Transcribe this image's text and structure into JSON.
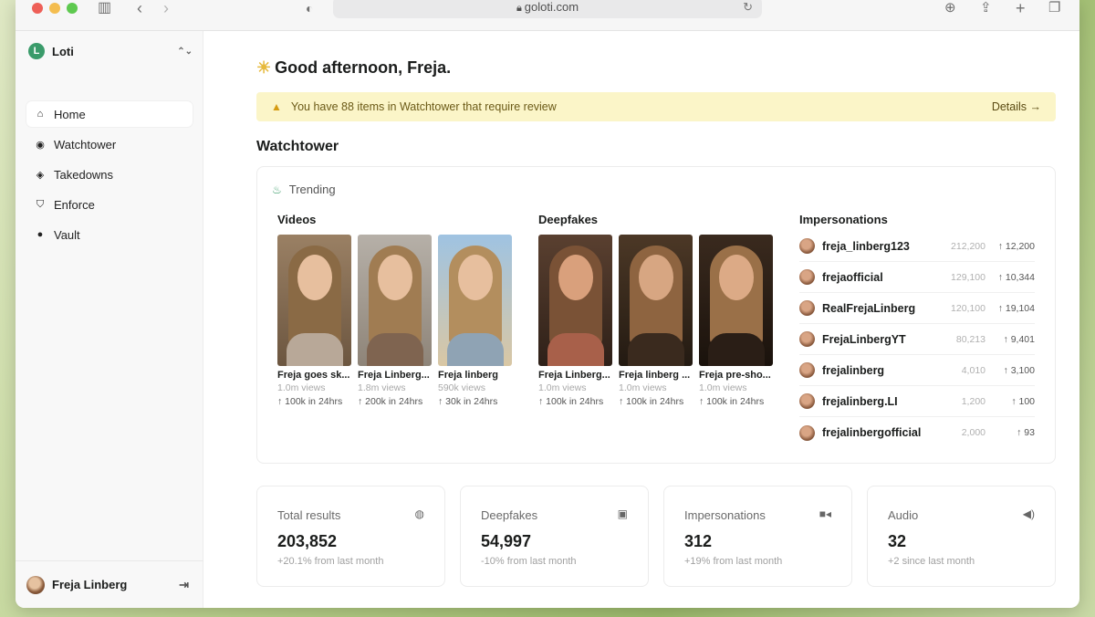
{
  "browser": {
    "url": "goloti.com",
    "icons": [
      "sidebar-toggle-icon",
      "back-icon",
      "forward-icon",
      "shield-icon",
      "lock-icon",
      "reload-icon",
      "download-icon",
      "share-icon",
      "new-tab-icon",
      "tabs-icon"
    ]
  },
  "sidebar": {
    "org_initial": "L",
    "org_name": "Loti",
    "items": [
      {
        "label": "Home",
        "icon": "home-icon",
        "active": true
      },
      {
        "label": "Watchtower",
        "icon": "watchtower-icon",
        "active": false
      },
      {
        "label": "Takedowns",
        "icon": "layers-icon",
        "active": false
      },
      {
        "label": "Enforce",
        "icon": "shield-check-icon",
        "active": false
      },
      {
        "label": "Vault",
        "icon": "user-circle-icon",
        "active": false
      }
    ],
    "user_name": "Freja Linberg"
  },
  "main": {
    "greeting": "Good afternoon, Freja.",
    "banner": {
      "text": "You have 88 items in Watchtower that require review",
      "link": "Details →"
    },
    "section_title": "Watchtower",
    "trending_label": "Trending",
    "videos": {
      "title": "Videos",
      "items": [
        {
          "title": "Freja goes sk...",
          "views": "1.0m views",
          "trend": "↑ 100k in 24hrs"
        },
        {
          "title": "Freja Linberg...",
          "views": "1.8m views",
          "trend": "↑ 200k in 24hrs"
        },
        {
          "title": "Freja linberg",
          "views": "590k views",
          "trend": "↑ 30k in 24hrs"
        }
      ]
    },
    "deepfakes": {
      "title": "Deepfakes",
      "items": [
        {
          "title": "Freja Linberg...",
          "views": "1.0m views",
          "trend": "↑ 100k in 24hrs"
        },
        {
          "title": "Freja linberg ...",
          "views": "1.0m views",
          "trend": "↑ 100k in 24hrs"
        },
        {
          "title": "Freja pre-sho...",
          "views": "1.0m views",
          "trend": "↑ 100k in 24hrs"
        }
      ]
    },
    "impersonations": {
      "title": "Impersonations",
      "items": [
        {
          "name": "freja_linberg123",
          "count": "212,200",
          "delta": "↑ 12,200"
        },
        {
          "name": "frejaofficial",
          "count": "129,100",
          "delta": "↑ 10,344"
        },
        {
          "name": "RealFrejaLinberg",
          "count": "120,100",
          "delta": "↑ 19,104"
        },
        {
          "name": "FrejaLinbergYT",
          "count": "80,213",
          "delta": "↑ 9,401"
        },
        {
          "name": "frejalinberg",
          "count": "4,010",
          "delta": "↑ 3,100"
        },
        {
          "name": "frejalinberg.LI",
          "count": "1,200",
          "delta": "↑ 100"
        },
        {
          "name": "frejalinbergofficial",
          "count": "2,000",
          "delta": "↑ 93"
        }
      ]
    },
    "stats": [
      {
        "label": "Total results",
        "value": "203,852",
        "sub": "+20.1% from last month",
        "icon": "globe-icon"
      },
      {
        "label": "Deepfakes",
        "value": "54,997",
        "sub": "-10% from last month",
        "icon": "image-icon"
      },
      {
        "label": "Impersonations",
        "value": "312",
        "sub": "+19% from last month",
        "icon": "video-icon"
      },
      {
        "label": "Audio",
        "value": "32",
        "sub": "+2 since last month",
        "icon": "speaker-icon"
      }
    ]
  }
}
